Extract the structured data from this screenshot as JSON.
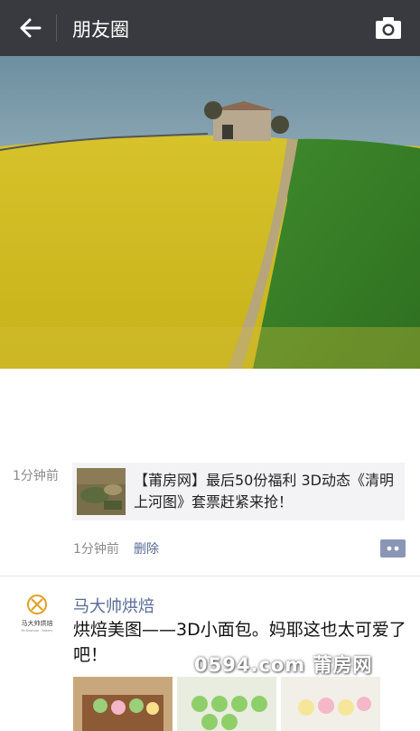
{
  "header": {
    "title": "朋友圈",
    "back_icon": "back-arrow-icon",
    "camera_icon": "camera-icon",
    "bg_color": "#393a3f"
  },
  "moment1": {
    "timestamp_left": "1分钟前",
    "link_text": "【莆房网】最后50份福利 3D动态《清明上河图》套票赶紧来抢！",
    "timestamp": "1分钟前",
    "delete_label": "删除",
    "link_color": "#576b95"
  },
  "moment2": {
    "nickname": "马大帅烘焙",
    "avatar_name": "马大帅烘焙",
    "avatar_sub": "Mr.Dashuai · Bakery",
    "text": "烘焙美图——3D小面包。妈耶这也太可爱了吧！"
  },
  "watermark": "0594.com 莆房网"
}
